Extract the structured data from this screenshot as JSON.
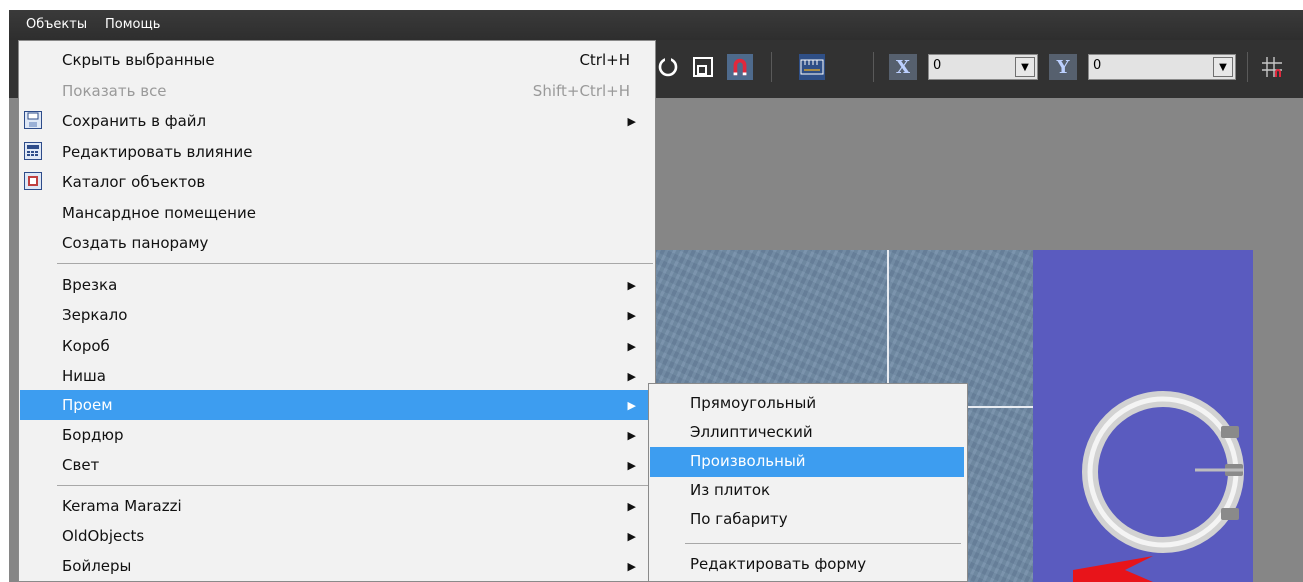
{
  "menubar": {
    "items": [
      {
        "label": "Объекты"
      },
      {
        "label": "Помощь"
      }
    ]
  },
  "toolbar": {
    "x_axis": {
      "label": "X",
      "value": "0"
    },
    "y_axis": {
      "label": "Y",
      "value": "0"
    },
    "icons": [
      "rotate-icon",
      "frame-icon",
      "magnet-icon",
      "ruler-icon",
      "grid-snap-icon"
    ]
  },
  "menu": {
    "items": [
      {
        "label": "Скрыть выбранные",
        "shortcut": "Ctrl+H"
      },
      {
        "label": "Показать все",
        "shortcut": "Shift+Ctrl+H",
        "disabled": true
      },
      {
        "label": "Сохранить в файл",
        "submenu": true,
        "icon": "save-file-icon"
      },
      {
        "label": "Редактировать влияние",
        "icon": "calculator-icon"
      },
      {
        "label": "Каталог объектов",
        "icon": "catalog-icon"
      },
      {
        "label": "Мансардное помещение"
      },
      {
        "label": "Создать панораму"
      },
      {
        "label": "Врезка",
        "submenu": true
      },
      {
        "label": "Зеркало",
        "submenu": true
      },
      {
        "label": "Короб",
        "submenu": true
      },
      {
        "label": "Ниша",
        "submenu": true
      },
      {
        "label": "Проем",
        "submenu": true,
        "highlighted": true
      },
      {
        "label": "Бордюр",
        "submenu": true
      },
      {
        "label": "Свет",
        "submenu": true
      },
      {
        "label": "Kerama Marazzi",
        "submenu": true
      },
      {
        "label": "OldObjects",
        "submenu": true
      },
      {
        "label": "Бойлеры",
        "submenu": true
      }
    ]
  },
  "submenu": {
    "items": [
      {
        "label": "Прямоугольный"
      },
      {
        "label": "Эллиптический"
      },
      {
        "label": "Произвольный",
        "highlighted": true
      },
      {
        "label": "Из плиток"
      },
      {
        "label": "По габариту"
      },
      {
        "label": "Редактировать форму"
      }
    ]
  },
  "colors": {
    "highlight": "#3d9df0",
    "menu_bg": "#f2f2f2",
    "wall_panel": "#5a5bbf"
  }
}
